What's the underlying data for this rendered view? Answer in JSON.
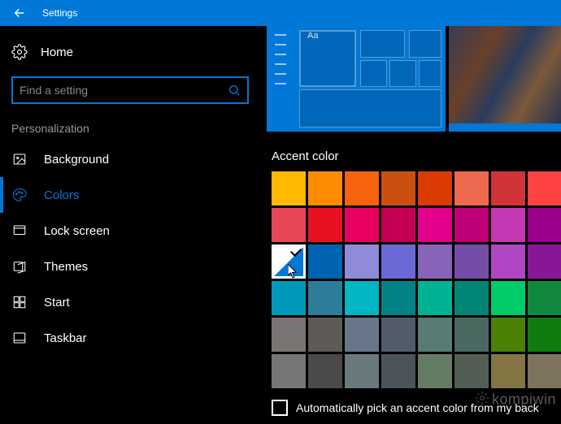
{
  "titlebar": {
    "title": "Settings"
  },
  "sidebar": {
    "home_label": "Home",
    "search_placeholder": "Find a setting",
    "section_header": "Personalization",
    "items": [
      {
        "label": "Background"
      },
      {
        "label": "Colors"
      },
      {
        "label": "Lock screen"
      },
      {
        "label": "Themes"
      },
      {
        "label": "Start"
      },
      {
        "label": "Taskbar"
      }
    ]
  },
  "main": {
    "preview_label": "Aa",
    "accent_header": "Accent color",
    "auto_pick_label": "Automatically pick an accent color from my back",
    "selected_swatch_index": 16,
    "swatches": [
      "#ffb900",
      "#ff8c00",
      "#f7630c",
      "#ca5010",
      "#da3b01",
      "#ef6950",
      "#d13438",
      "#ff4343",
      "#e74856",
      "#e81123",
      "#ea005e",
      "#c30052",
      "#e3008c",
      "#bf0077",
      "#c239b3",
      "#9a0089",
      "#0078d7",
      "#0063b1",
      "#8e8cd8",
      "#6b69d6",
      "#8764b8",
      "#744da9",
      "#b146c2",
      "#881798",
      "#0099bc",
      "#2d7d9a",
      "#00b7c3",
      "#038387",
      "#00b294",
      "#018574",
      "#00cc6a",
      "#10893e",
      "#7a7574",
      "#5d5a58",
      "#68768a",
      "#515c6b",
      "#567c73",
      "#486860",
      "#498205",
      "#107c10",
      "#767676",
      "#4c4a48",
      "#69797e",
      "#4a5459",
      "#647c64",
      "#525e54",
      "#847545",
      "#7e735f"
    ]
  },
  "watermark": "kompiwin"
}
